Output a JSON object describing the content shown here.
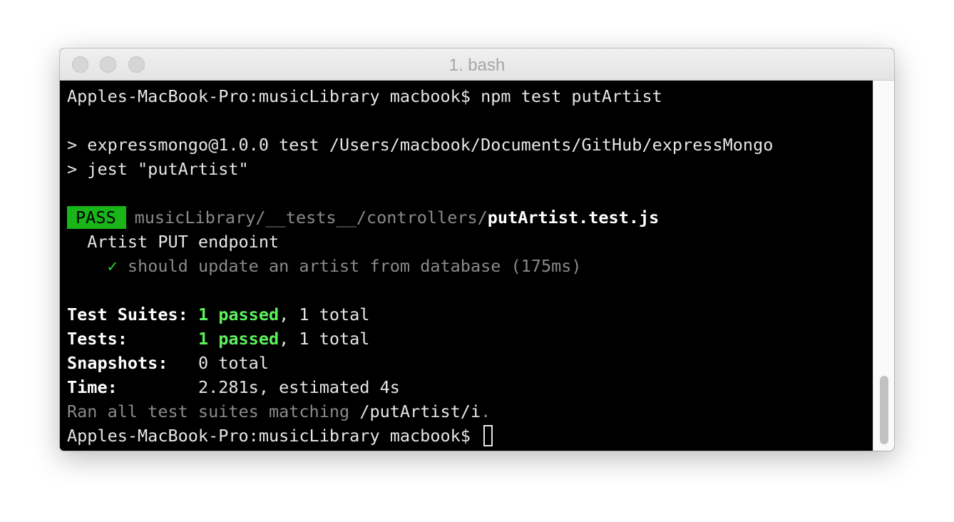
{
  "window": {
    "title": "1. bash"
  },
  "terminal": {
    "prompt": "Apples-MacBook-Pro:musicLibrary macbook$",
    "command": "npm test putArtist",
    "npm_script_line": "> expressmongo@1.0.0 test /Users/macbook/Documents/GitHub/expressMongo",
    "jest_line": "> jest \"putArtist\"",
    "result": {
      "badge": "PASS",
      "path_dir": "musicLibrary/__tests__/controllers/",
      "path_file": "putArtist.test.js",
      "describe": "Artist PUT endpoint",
      "check_mark": "✓",
      "test_name": "should update an artist from database (175ms)"
    },
    "summary": {
      "suites_label": "Test Suites:",
      "suites_passed": "1 passed",
      "suites_total": ", 1 total",
      "tests_label": "Tests:",
      "tests_passed": "1 passed",
      "tests_total": ", 1 total",
      "snapshots_label": "Snapshots:",
      "snapshots_value": "0 total",
      "time_label": "Time:",
      "time_value": "2.281s, estimated 4s",
      "ran_prefix": "Ran all test suites matching ",
      "ran_pattern": "/putArtist/i",
      "ran_suffix": "."
    }
  }
}
